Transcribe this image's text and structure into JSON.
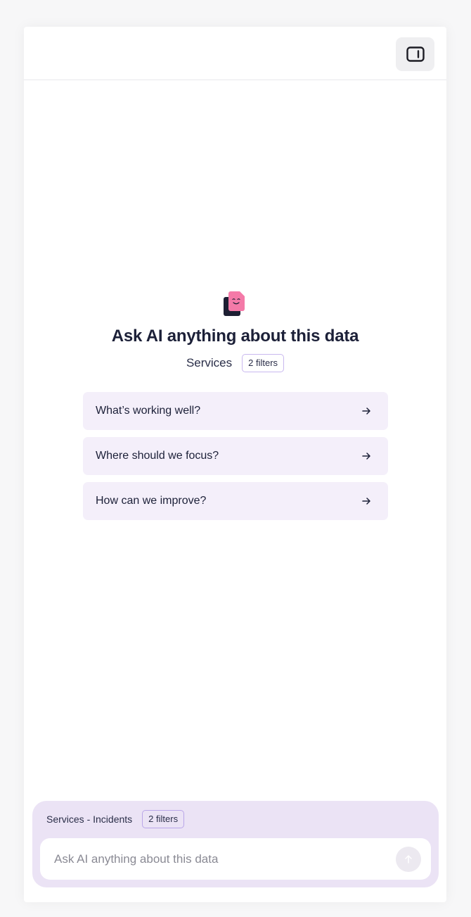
{
  "header": {
    "toggle_icon": "sidebar-toggle-icon"
  },
  "hero": {
    "logo_icon": "ai-assistant-logo",
    "title": "Ask AI anything about this data",
    "context_label": "Services",
    "filter_badge": "2 filters"
  },
  "suggestions": [
    {
      "label": "What’s working well?",
      "icon": "arrow-right-icon"
    },
    {
      "label": "Where should we focus?",
      "icon": "arrow-right-icon"
    },
    {
      "label": "How can we improve?",
      "icon": "arrow-right-icon"
    }
  ],
  "composer": {
    "context_label": "Services - Incidents",
    "filter_badge": "2 filters",
    "placeholder": "Ask AI anything about this data",
    "value": "",
    "send_icon": "arrow-up-icon"
  },
  "colors": {
    "accent_pink": "#f47aa8",
    "dark_navy": "#1c2038",
    "suggestion_bg": "#f4effa",
    "composer_bg": "#ebe3f5",
    "badge_border": "#c9b8ef"
  }
}
